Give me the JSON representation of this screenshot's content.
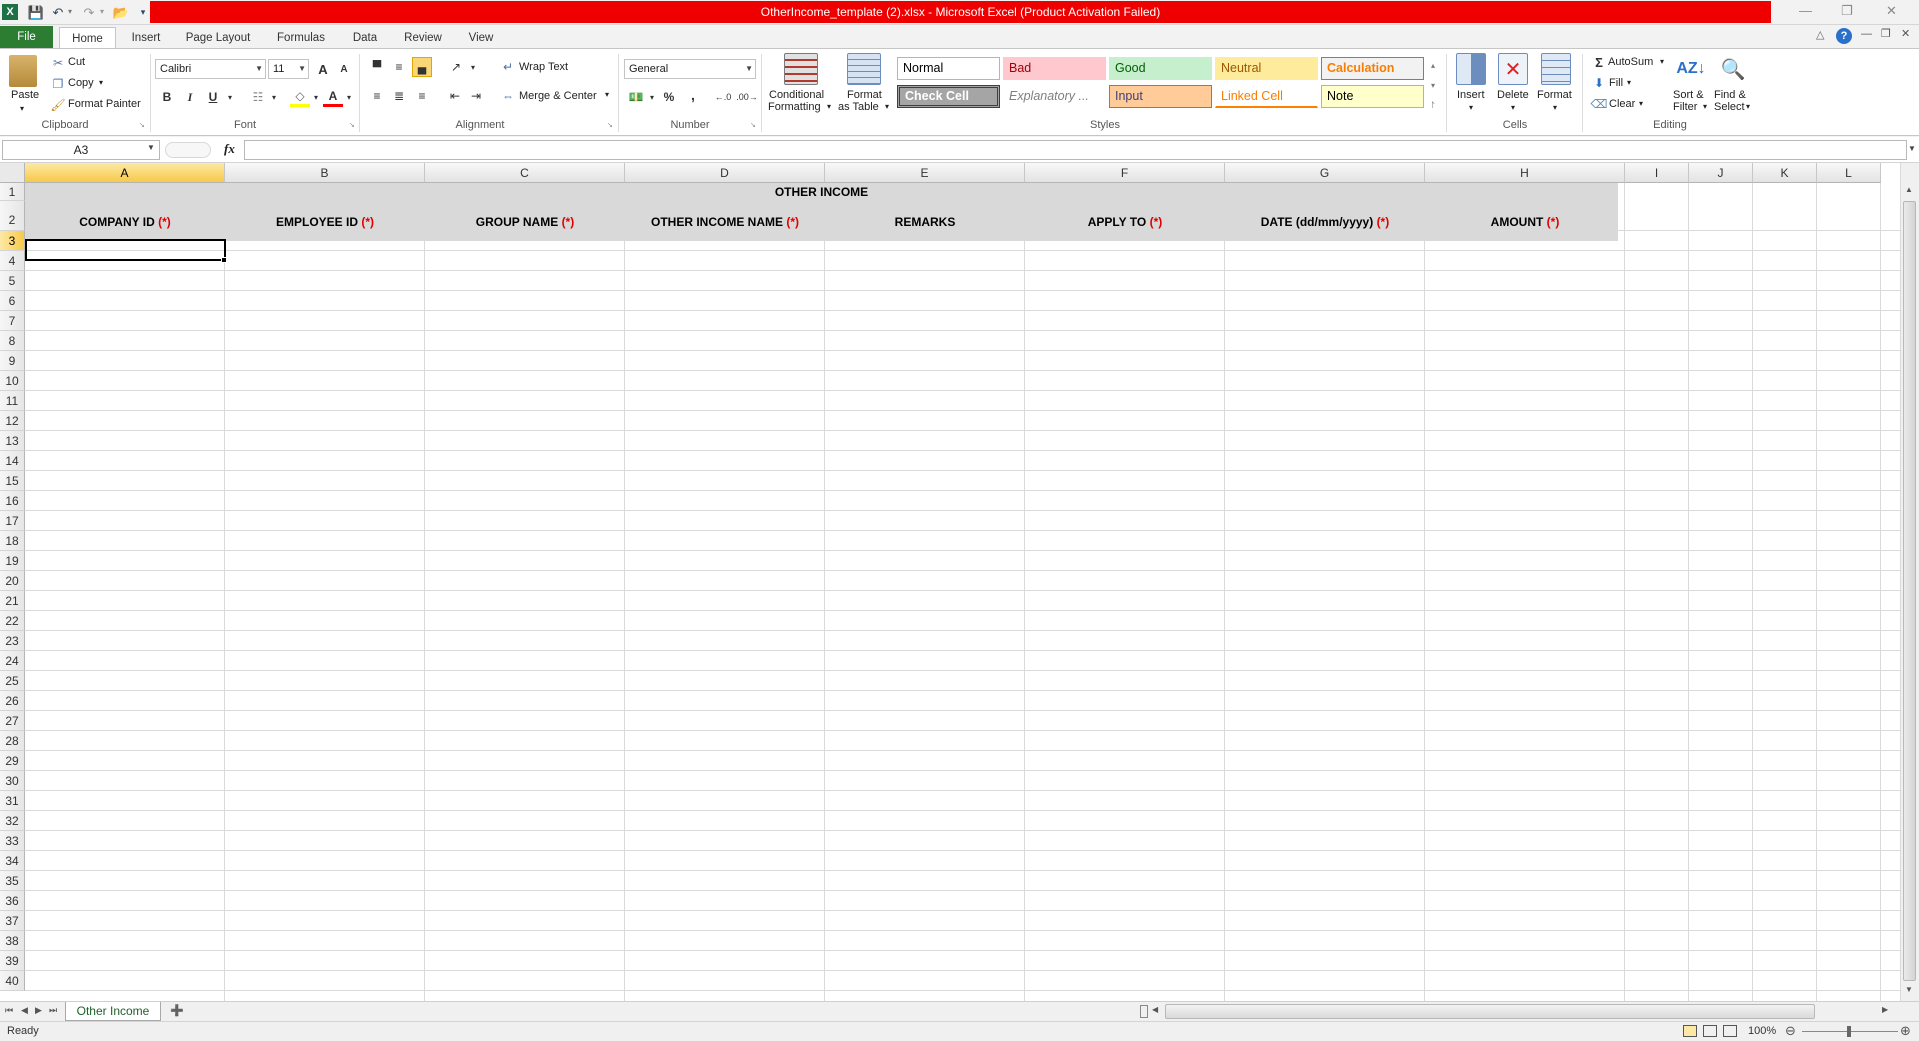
{
  "window": {
    "title": "OtherIncome_template (2).xlsx  -  Microsoft Excel (Product Activation Failed)",
    "title_bar_color": "#ee0000"
  },
  "tabs": [
    "File",
    "Home",
    "Insert",
    "Page Layout",
    "Formulas",
    "Data",
    "Review",
    "View"
  ],
  "active_tab": "Home",
  "ribbon": {
    "clipboard": {
      "paste": "Paste",
      "cut": "Cut",
      "copy": "Copy",
      "format_painter": "Format Painter",
      "label": "Clipboard"
    },
    "font": {
      "name": "Calibri",
      "size": "11",
      "bold": "B",
      "italic": "I",
      "underline": "U",
      "grow": "A",
      "shrink": "A",
      "font_color_letter": "A",
      "label": "Font"
    },
    "alignment": {
      "wrap_text": "Wrap Text",
      "merge_center": "Merge & Center",
      "label": "Alignment"
    },
    "number": {
      "format": "General",
      "percent": "%",
      "comma": ",",
      "label": "Number"
    },
    "styles": {
      "conditional_1": "Conditional",
      "conditional_2": "Formatting",
      "format_table_1": "Format",
      "format_table_2": "as Table",
      "cells": [
        {
          "label": "Normal",
          "bg": "#ffffff",
          "color": "#000000"
        },
        {
          "label": "Bad",
          "bg": "#ffc7ce",
          "color": "#9c0006"
        },
        {
          "label": "Good",
          "bg": "#c6efce",
          "color": "#006100"
        },
        {
          "label": "Neutral",
          "bg": "#ffeb9c",
          "color": "#9c5700"
        },
        {
          "label": "Calculation",
          "bg": "#f2f2f2",
          "color": "#fa7d00"
        },
        {
          "label": "Check Cell",
          "bg": "#a5a5a5",
          "color": "#ffffff"
        },
        {
          "label": "Explanatory ...",
          "bg": "#ffffff",
          "color": "#7f7f7f"
        },
        {
          "label": "Input",
          "bg": "#ffcc99",
          "color": "#3f3f76"
        },
        {
          "label": "Linked Cell",
          "bg": "#ffffff",
          "color": "#fa7d00"
        },
        {
          "label": "Note",
          "bg": "#ffffcc",
          "color": "#000000"
        }
      ],
      "label": "Styles"
    },
    "cells": {
      "insert": "Insert",
      "delete": "Delete",
      "format": "Format",
      "label": "Cells"
    },
    "editing": {
      "autosum": "AutoSum",
      "fill": "Fill",
      "clear": "Clear",
      "sort_1": "Sort &",
      "sort_2": "Filter",
      "find_1": "Find &",
      "find_2": "Select",
      "label": "Editing"
    }
  },
  "formula_bar": {
    "name_box": "A3",
    "fx": "fx",
    "value": ""
  },
  "columns": [
    "A",
    "B",
    "C",
    "D",
    "E",
    "F",
    "G",
    "H",
    "I",
    "J",
    "K",
    "L"
  ],
  "rows": [
    "1",
    "2",
    "3",
    "4",
    "5",
    "6",
    "7",
    "8",
    "9",
    "10",
    "11",
    "12",
    "13",
    "14",
    "15",
    "16",
    "17",
    "18",
    "19",
    "20",
    "21",
    "22",
    "23",
    "24",
    "25",
    "26",
    "27",
    "28",
    "29",
    "30",
    "31",
    "32",
    "33",
    "34",
    "35",
    "36",
    "37",
    "38",
    "39",
    "40"
  ],
  "selected_cell": "A3",
  "sheet": {
    "title": "OTHER INCOME",
    "headers": [
      {
        "text": "COMPANY ID",
        "req": "(*)"
      },
      {
        "text": "EMPLOYEE ID",
        "req": "(*)"
      },
      {
        "text": "GROUP NAME",
        "req": "(*)"
      },
      {
        "text": "OTHER INCOME NAME",
        "req": "(*)"
      },
      {
        "text": "REMARKS",
        "req": ""
      },
      {
        "text": "APPLY TO",
        "req": "(*)"
      },
      {
        "text": "DATE (dd/mm/yyyy)",
        "req": "(*)"
      },
      {
        "text": "AMOUNT",
        "req": "(*)"
      }
    ]
  },
  "sheet_tabs": [
    "Other Income"
  ],
  "status": {
    "ready": "Ready",
    "zoom": "100%"
  }
}
